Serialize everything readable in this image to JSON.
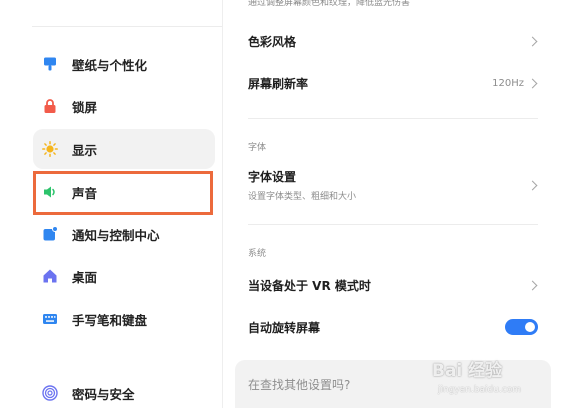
{
  "sidebar": {
    "items": [
      {
        "label": "壁纸与个性化",
        "icon": "wallpaper-icon",
        "color": "#2f86f0"
      },
      {
        "label": "锁屏",
        "icon": "lock-icon",
        "color": "#f25b4a"
      },
      {
        "label": "显示",
        "icon": "sun-icon",
        "color": "#f5b51c"
      },
      {
        "label": "声音",
        "icon": "speaker-icon",
        "color": "#2cc36b"
      },
      {
        "label": "通知与控制中心",
        "icon": "notification-icon",
        "color": "#2f86f0"
      },
      {
        "label": "桌面",
        "icon": "home-icon",
        "color": "#6b73f0"
      },
      {
        "label": "手写笔和键盘",
        "icon": "keyboard-icon",
        "color": "#2f86f0"
      },
      {
        "label": "密码与安全",
        "icon": "fingerprint-icon",
        "color": "#6b73f0"
      }
    ],
    "selected": "显示",
    "highlighted": "声音",
    "highlight_color": "#ec6a3c"
  },
  "content": {
    "hint": "通过调整屏幕颜色和纹理，降低蓝光伤害",
    "color_style": {
      "title": "色彩风格"
    },
    "refresh_rate": {
      "title": "屏幕刷新率",
      "value": "120Hz"
    },
    "font_section": {
      "label": "字体"
    },
    "font_settings": {
      "title": "字体设置",
      "subtitle": "设置字体类型、粗细和大小"
    },
    "system_section": {
      "label": "系统"
    },
    "vr_mode": {
      "title": "当设备处于 VR 模式时"
    },
    "auto_rotate": {
      "title": "自动旋转屏幕",
      "enabled": true,
      "toggle_color": "#2f7cf6"
    },
    "search": {
      "placeholder": "在查找其他设置吗?"
    }
  },
  "watermark": {
    "text": "Bai 经验",
    "sub": "jingyan.baidu.com"
  }
}
